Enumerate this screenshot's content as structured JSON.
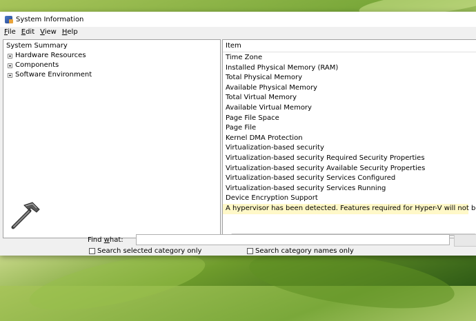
{
  "window": {
    "title": "System Information"
  },
  "menu": {
    "items": [
      "File",
      "Edit",
      "View",
      "Help"
    ]
  },
  "tree": {
    "root": "System Summary",
    "nodes": [
      "Hardware Resources",
      "Components",
      "Software Environment"
    ]
  },
  "list": {
    "header": "Item",
    "rows": [
      "Time Zone",
      "Installed Physical Memory (RAM)",
      "Total Physical Memory",
      "Available Physical Memory",
      "Total Virtual Memory",
      "Available Virtual Memory",
      "Page File Space",
      "Page File",
      "Kernel DMA Protection",
      "Virtualization-based security",
      "Virtualization-based security Required Security Properties",
      "Virtualization-based security Available Security Properties",
      "Virtualization-based security Services Configured",
      "Virtualization-based security Services Running",
      "Device Encryption Support"
    ],
    "note": "A hypervisor has been detected. Features required for Hyper-V will not be displayed."
  },
  "find": {
    "label": "Find what:",
    "value": "",
    "option_selected": "Search selected category only",
    "option_names": "Search category names only"
  },
  "colors": {
    "note_highlight": "#fff8c8",
    "window_bg": "#f0f0f0"
  }
}
